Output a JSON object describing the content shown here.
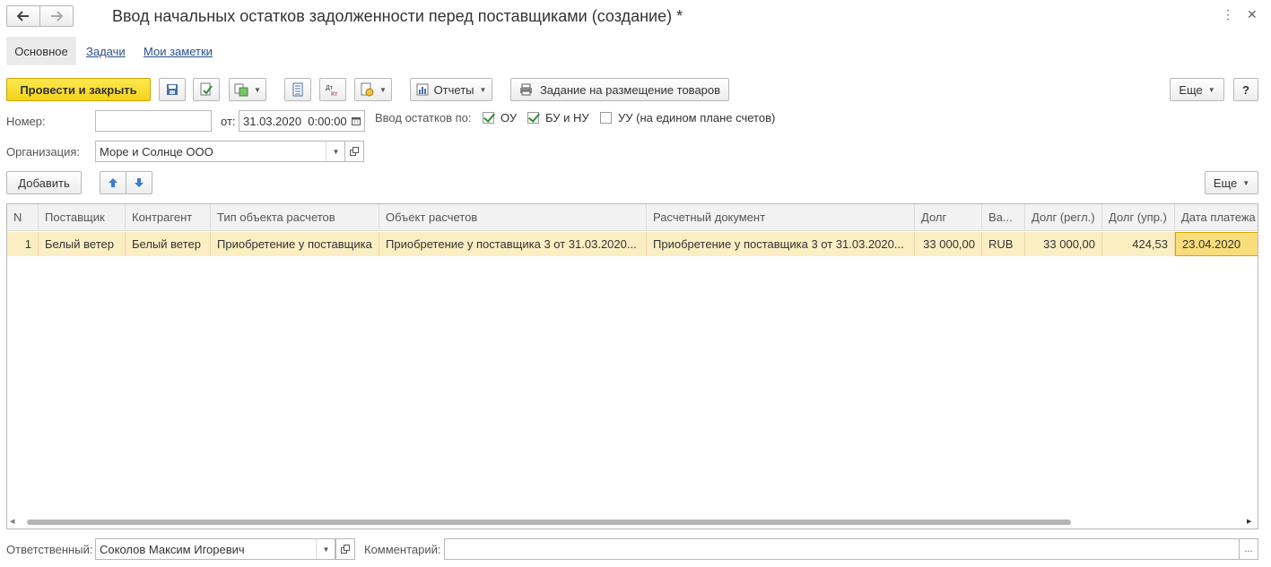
{
  "header": {
    "title": "Ввод начальных остатков задолженности перед поставщиками (создание) *"
  },
  "tabs": [
    {
      "label": "Основное"
    },
    {
      "label": "Задачи"
    },
    {
      "label": "Мои заметки"
    }
  ],
  "toolbar": {
    "post_close_label": "Провести и закрыть",
    "reports_label": "Отчеты",
    "print_task_label": "Задание на размещение товаров",
    "more_label": "Еще",
    "help_label": "?"
  },
  "form": {
    "number_label": "Номер:",
    "number_value": "",
    "date_label": "от:",
    "date_value": "31.03.2020  0:00:00",
    "balances_label": "Ввод остатков по:",
    "cb_ou_label": "ОУ",
    "cb_bu_label": "БУ и НУ",
    "cb_uu_label": "УУ (на едином плане счетов)",
    "org_label": "Организация:",
    "org_value": "Море и Солнце ООО"
  },
  "table_toolbar": {
    "add_label": "Добавить",
    "more_label": "Еще"
  },
  "table": {
    "columns": [
      "N",
      "Поставщик",
      "Контрагент",
      "Тип объекта расчетов",
      "Объект расчетов",
      "Расчетный документ",
      "Долг",
      "Ва...",
      "Долг (регл.)",
      "Долг (упр.)",
      "Дата платежа"
    ],
    "rows": [
      {
        "n": "1",
        "supplier": "Белый ветер",
        "counterparty": "Белый ветер",
        "object_type": "Приобретение у поставщика",
        "object": "Приобретение у поставщика 3 от 31.03.2020...",
        "document": "Приобретение у поставщика 3 от 31.03.2020...",
        "debt": "33 000,00",
        "currency": "RUB",
        "debt_reg": "33 000,00",
        "debt_mgmt": "424,53",
        "pay_date": "23.04.2020"
      }
    ]
  },
  "footer": {
    "responsible_label": "Ответственный:",
    "responsible_value": "Соколов Максим Игоревич",
    "comment_label": "Комментарий:",
    "comment_value": "",
    "comment_btn": "..."
  },
  "colors": {
    "accent_yellow": "#f4d31a",
    "row_selected": "#fbeec3",
    "link": "#2a4f8f",
    "check_green": "#2f8f3a"
  }
}
